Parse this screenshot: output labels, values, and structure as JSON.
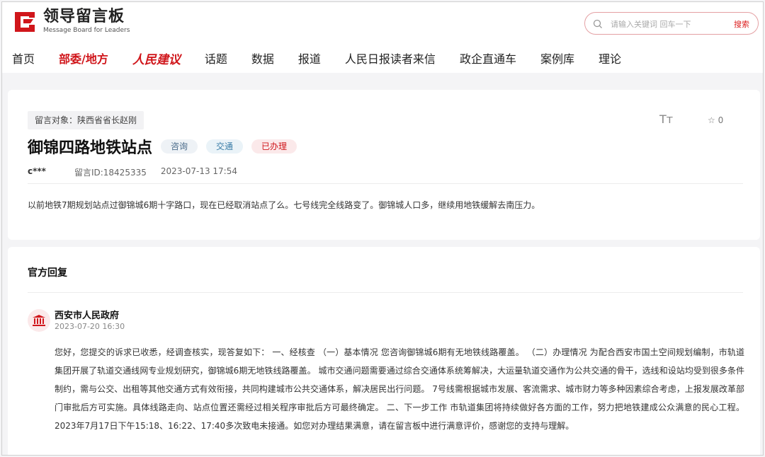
{
  "header": {
    "logo_title": "领导留言板",
    "logo_subtitle": "Message Board for Leaders",
    "search_placeholder": "请输入关键词 回车一下",
    "search_button": "搜索"
  },
  "nav": [
    {
      "label": "首页"
    },
    {
      "label": "部委/地方"
    },
    {
      "label": "人民建议"
    },
    {
      "label": "话题"
    },
    {
      "label": "数据"
    },
    {
      "label": "报道"
    },
    {
      "label": "人民日报读者来信"
    },
    {
      "label": "政企直通车"
    },
    {
      "label": "案例库"
    },
    {
      "label": "理论"
    }
  ],
  "message": {
    "target": "留言对象：陕西省省长赵刚",
    "title": "御锦四路地铁站点",
    "tags": [
      "咨询",
      "交通",
      "已办理"
    ],
    "author": "c***",
    "id_label": "留言ID:18425335",
    "time": "2023-07-13 17:54",
    "content": "以前地铁7期规划站点过御锦城6期十字路口，现在已经取消站点了么。七号线完全线路变了。御锦城人口多，继续用地铁缓解去南压力。",
    "font_toggle": "Tт",
    "favorite_count": "☆ 0"
  },
  "reply": {
    "section_title": "官方回复",
    "org": "西安市人民政府",
    "time": "2023-07-20 16:30",
    "body": "您好，您提交的诉求已收悉，经调查核实，现答复如下： 一、经核查 （一）基本情况 您咨询御锦城6期有无地铁线路覆盖。 （二）办理情况 为配合西安市国土空间规划编制，市轨道集团开展了轨道交通线网专业规划研究，御锦城6期无地铁线路覆盖。 城市交通问题需要通过综合交通体系统筹解决，大运量轨道交通作为公共交通的骨干，选线和设站均受到很多条件制约，需与公交、出租等其他交通方式有效衔接，共同构建城市公共交通体系，解决居民出行问题。 7号线需根据城市发展、客流需求、城市财力等多种因素综合考虑，上报发展改革部门审批后方可实施。具体线路走向、站点位置还需经过相关程序审批后方可最终确定。 二、下一步工作 市轨道集团将持续做好各方面的工作，努力把地铁建成公众满意的民心工程。 2023年7月17日下午15:18、16:22、17:40多次致电未接通。如您对办理结果满意，请在留言板中进行满意评价，感谢您的支持与理解。"
  },
  "colors": {
    "brand_red": "#d0161b",
    "tag_red_bg": "#fbe9ea"
  }
}
